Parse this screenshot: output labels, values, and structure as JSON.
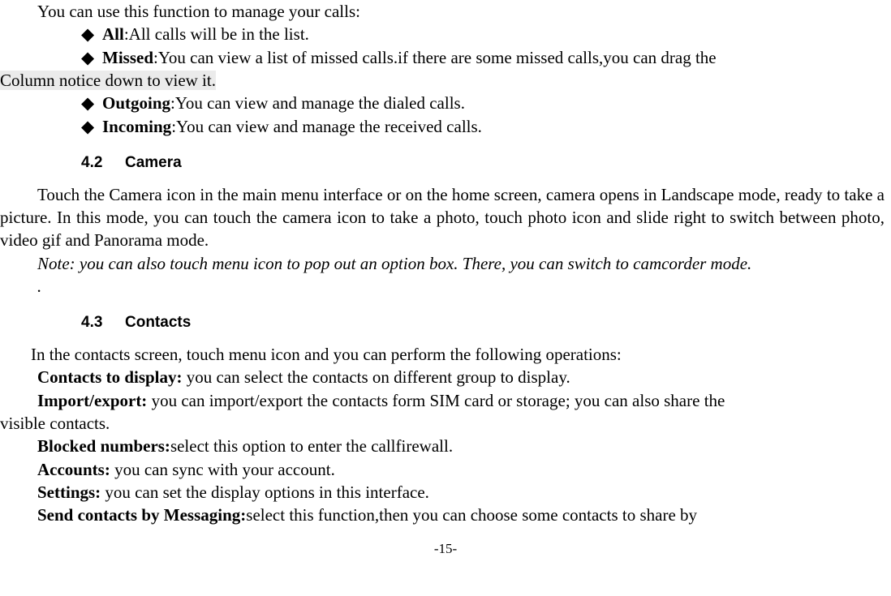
{
  "intro": "You can use this function to manage your calls:",
  "bullets": {
    "all": {
      "label": "All",
      "text": ":All calls will be in the list."
    },
    "missed": {
      "label": "Missed",
      "text_part1": ":You can view a list of missed calls.if there are some missed calls,you can drag the",
      "text_part2": "Column notice down to view it."
    },
    "outgoing": {
      "label": "Outgoing",
      "text": ":You can view and manage the dialed calls."
    },
    "incoming": {
      "label": "Incoming",
      "text": ":You can view and manage the received calls."
    }
  },
  "section42": {
    "num": "4.2",
    "title": "Camera"
  },
  "camera_para": "Touch the Camera icon in the main menu interface or on the home screen, camera opens in Landscape mode, ready to take a picture. In this mode, you can touch the camera icon to take a photo, touch photo icon and slide right to switch between photo, video gif and Panorama mode.",
  "camera_note": "Note: you can also touch menu icon to pop out an option box. There, you can switch to camcorder mode.",
  "camera_dot": ".",
  "section43": {
    "num": "4.3",
    "title": "Contacts"
  },
  "contacts_intro": "In the contacts screen, touch menu icon and you can perform the following operations:",
  "contacts": {
    "display": {
      "label": "Contacts to display:",
      "text": " you can select the contacts on different group to display."
    },
    "import": {
      "label": "Import/export:",
      "text_part1": " you can import/export the contacts form SIM card or storage; you can also share the",
      "text_part2": "visible contacts."
    },
    "blocked": {
      "label": "Blocked numbers:",
      "text": "select this option to enter the callfirewall."
    },
    "accounts": {
      "label": "Accounts:",
      "text": " you can sync with your account."
    },
    "settings": {
      "label": "Settings:",
      "text": " you can set the display options in this interface."
    },
    "send": {
      "label": "Send contacts by Messaging:",
      "text": "select this function,then you can choose some contacts to share by"
    }
  },
  "page_num": "-15-",
  "diamond_glyph": "◆"
}
